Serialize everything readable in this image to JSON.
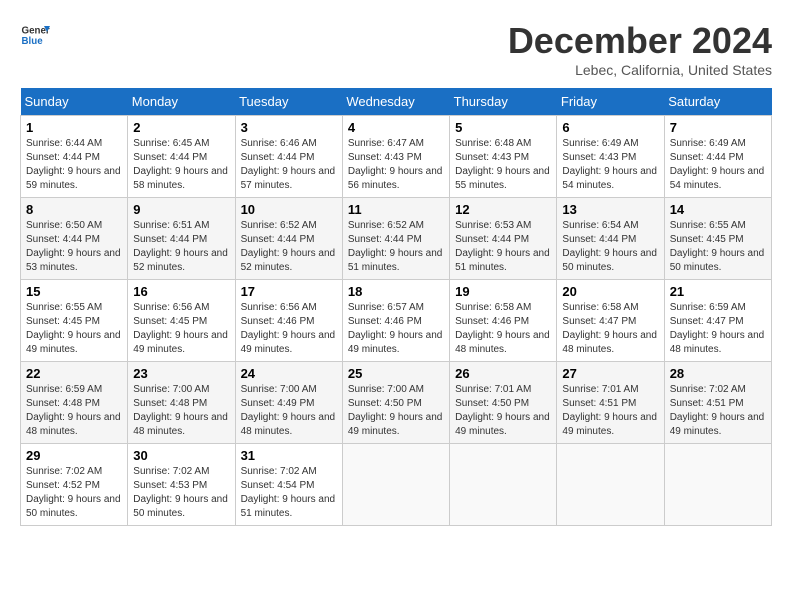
{
  "logo": {
    "general": "General",
    "blue": "Blue"
  },
  "header": {
    "month": "December 2024",
    "location": "Lebec, California, United States"
  },
  "weekdays": [
    "Sunday",
    "Monday",
    "Tuesday",
    "Wednesday",
    "Thursday",
    "Friday",
    "Saturday"
  ],
  "weeks": [
    [
      {
        "day": "1",
        "sunrise": "6:44 AM",
        "sunset": "4:44 PM",
        "daylight": "9 hours and 59 minutes."
      },
      {
        "day": "2",
        "sunrise": "6:45 AM",
        "sunset": "4:44 PM",
        "daylight": "9 hours and 58 minutes."
      },
      {
        "day": "3",
        "sunrise": "6:46 AM",
        "sunset": "4:44 PM",
        "daylight": "9 hours and 57 minutes."
      },
      {
        "day": "4",
        "sunrise": "6:47 AM",
        "sunset": "4:43 PM",
        "daylight": "9 hours and 56 minutes."
      },
      {
        "day": "5",
        "sunrise": "6:48 AM",
        "sunset": "4:43 PM",
        "daylight": "9 hours and 55 minutes."
      },
      {
        "day": "6",
        "sunrise": "6:49 AM",
        "sunset": "4:43 PM",
        "daylight": "9 hours and 54 minutes."
      },
      {
        "day": "7",
        "sunrise": "6:49 AM",
        "sunset": "4:44 PM",
        "daylight": "9 hours and 54 minutes."
      }
    ],
    [
      {
        "day": "8",
        "sunrise": "6:50 AM",
        "sunset": "4:44 PM",
        "daylight": "9 hours and 53 minutes."
      },
      {
        "day": "9",
        "sunrise": "6:51 AM",
        "sunset": "4:44 PM",
        "daylight": "9 hours and 52 minutes."
      },
      {
        "day": "10",
        "sunrise": "6:52 AM",
        "sunset": "4:44 PM",
        "daylight": "9 hours and 52 minutes."
      },
      {
        "day": "11",
        "sunrise": "6:52 AM",
        "sunset": "4:44 PM",
        "daylight": "9 hours and 51 minutes."
      },
      {
        "day": "12",
        "sunrise": "6:53 AM",
        "sunset": "4:44 PM",
        "daylight": "9 hours and 51 minutes."
      },
      {
        "day": "13",
        "sunrise": "6:54 AM",
        "sunset": "4:44 PM",
        "daylight": "9 hours and 50 minutes."
      },
      {
        "day": "14",
        "sunrise": "6:55 AM",
        "sunset": "4:45 PM",
        "daylight": "9 hours and 50 minutes."
      }
    ],
    [
      {
        "day": "15",
        "sunrise": "6:55 AM",
        "sunset": "4:45 PM",
        "daylight": "9 hours and 49 minutes."
      },
      {
        "day": "16",
        "sunrise": "6:56 AM",
        "sunset": "4:45 PM",
        "daylight": "9 hours and 49 minutes."
      },
      {
        "day": "17",
        "sunrise": "6:56 AM",
        "sunset": "4:46 PM",
        "daylight": "9 hours and 49 minutes."
      },
      {
        "day": "18",
        "sunrise": "6:57 AM",
        "sunset": "4:46 PM",
        "daylight": "9 hours and 49 minutes."
      },
      {
        "day": "19",
        "sunrise": "6:58 AM",
        "sunset": "4:46 PM",
        "daylight": "9 hours and 48 minutes."
      },
      {
        "day": "20",
        "sunrise": "6:58 AM",
        "sunset": "4:47 PM",
        "daylight": "9 hours and 48 minutes."
      },
      {
        "day": "21",
        "sunrise": "6:59 AM",
        "sunset": "4:47 PM",
        "daylight": "9 hours and 48 minutes."
      }
    ],
    [
      {
        "day": "22",
        "sunrise": "6:59 AM",
        "sunset": "4:48 PM",
        "daylight": "9 hours and 48 minutes."
      },
      {
        "day": "23",
        "sunrise": "7:00 AM",
        "sunset": "4:48 PM",
        "daylight": "9 hours and 48 minutes."
      },
      {
        "day": "24",
        "sunrise": "7:00 AM",
        "sunset": "4:49 PM",
        "daylight": "9 hours and 48 minutes."
      },
      {
        "day": "25",
        "sunrise": "7:00 AM",
        "sunset": "4:50 PM",
        "daylight": "9 hours and 49 minutes."
      },
      {
        "day": "26",
        "sunrise": "7:01 AM",
        "sunset": "4:50 PM",
        "daylight": "9 hours and 49 minutes."
      },
      {
        "day": "27",
        "sunrise": "7:01 AM",
        "sunset": "4:51 PM",
        "daylight": "9 hours and 49 minutes."
      },
      {
        "day": "28",
        "sunrise": "7:02 AM",
        "sunset": "4:51 PM",
        "daylight": "9 hours and 49 minutes."
      }
    ],
    [
      {
        "day": "29",
        "sunrise": "7:02 AM",
        "sunset": "4:52 PM",
        "daylight": "9 hours and 50 minutes."
      },
      {
        "day": "30",
        "sunrise": "7:02 AM",
        "sunset": "4:53 PM",
        "daylight": "9 hours and 50 minutes."
      },
      {
        "day": "31",
        "sunrise": "7:02 AM",
        "sunset": "4:54 PM",
        "daylight": "9 hours and 51 minutes."
      },
      null,
      null,
      null,
      null
    ]
  ],
  "labels": {
    "sunrise": "Sunrise:",
    "sunset": "Sunset:",
    "daylight": "Daylight:"
  }
}
